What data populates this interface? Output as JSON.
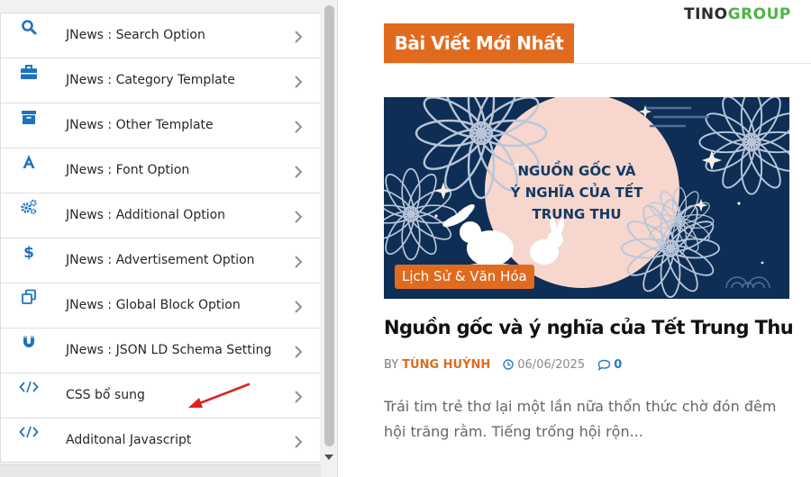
{
  "panel": {
    "menu": [
      {
        "label": "JNews : Search Option",
        "icon": "search-icon"
      },
      {
        "label": "JNews : Category Template",
        "icon": "briefcase-icon"
      },
      {
        "label": "JNews : Other Template",
        "icon": "archive-icon"
      },
      {
        "label": "JNews : Font Option",
        "icon": "font-icon"
      },
      {
        "label": "JNews : Additional Option",
        "icon": "gears-icon"
      },
      {
        "label": "JNews : Advertisement Option",
        "icon": "dollar-icon"
      },
      {
        "label": "JNews : Global Block Option",
        "icon": "copy-icon"
      },
      {
        "label": "JNews : JSON LD Schema Setting",
        "icon": "magnet-icon"
      },
      {
        "label": "CSS bổ sung",
        "icon": "code-icon"
      },
      {
        "label": "Additonal Javascript",
        "icon": "code-icon"
      }
    ]
  },
  "preview": {
    "logo": {
      "part1": "TINO",
      "part2": "GROUP"
    },
    "section_title": "Bài Viết Mới Nhất",
    "thumbnail_text": [
      "NGUỒN GỐC VÀ",
      "Ý NGHĨA CỦA TẾT",
      "TRUNG THU"
    ],
    "category": "Lịch Sử & Văn Hóa",
    "post_title": "Nguồn gốc và ý nghĩa của Tết Trung Thu",
    "meta": {
      "by": "BY",
      "author": "TÙNG HUỲNH",
      "date": "06/06/2025",
      "comments": "0"
    },
    "excerpt": "Trái tim trẻ thơ lại một lần nữa thổn thức chờ đón đêm hội trăng rằm. Tiếng trống hội rộn..."
  },
  "colors": {
    "accent": "#e06b1f",
    "icon_blue": "#1e73be",
    "logo_green": "#4cb543",
    "navy": "#0e2e55",
    "moon": "#f6d6cd",
    "arrow_red": "#e0201b"
  }
}
